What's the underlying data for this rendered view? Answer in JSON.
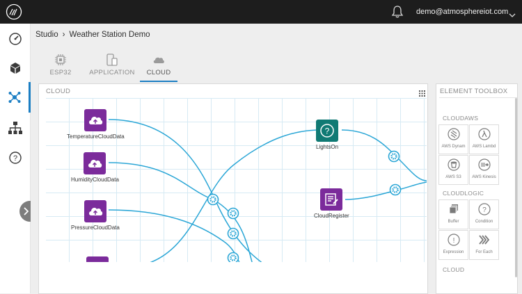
{
  "topbar": {
    "user_email": "demo@atmosphereiot.com"
  },
  "sidebar": {
    "items": [
      {
        "icon": "dashboard-gauge-icon"
      },
      {
        "icon": "cube-icon"
      },
      {
        "icon": "network-hub-icon",
        "active": true
      },
      {
        "icon": "org-chart-icon"
      },
      {
        "icon": "help-icon"
      }
    ]
  },
  "breadcrumb": {
    "root": "Studio",
    "separator": "›",
    "current": "Weather Station Demo"
  },
  "tabs": [
    {
      "label": "ESP32",
      "icon": "chip-icon"
    },
    {
      "label": "APPLICATION",
      "icon": "mobile-devices-icon"
    },
    {
      "label": "CLOUD",
      "icon": "cloud-icon",
      "active": true
    }
  ],
  "canvas": {
    "title": "CLOUD",
    "nodes": {
      "temperature": "TemperatureCloudData",
      "humidity": "HumidityCloudData",
      "pressure": "PressureCloudData",
      "lights_on": "LightsOn",
      "cloud_register": "CloudRegister"
    }
  },
  "toolbox": {
    "title": "ELEMENT TOOLBOX",
    "sections": [
      {
        "name": "CLOUDAWS",
        "items": [
          "AWS Dynam",
          "AWS Lambd",
          "AWS S3",
          "AWS Kinesis"
        ]
      },
      {
        "name": "CLOUDLOGIC",
        "items": [
          "Buffer",
          "Condition",
          "Expression",
          "For Each"
        ]
      },
      {
        "name": "CLOUD",
        "items": []
      }
    ]
  },
  "colors": {
    "topbar": "#1d1d1d",
    "accent": "#1b7ec3",
    "node_purple": "#7b2b9b",
    "node_teal": "#107a74",
    "wire": "#2aa6d6"
  }
}
